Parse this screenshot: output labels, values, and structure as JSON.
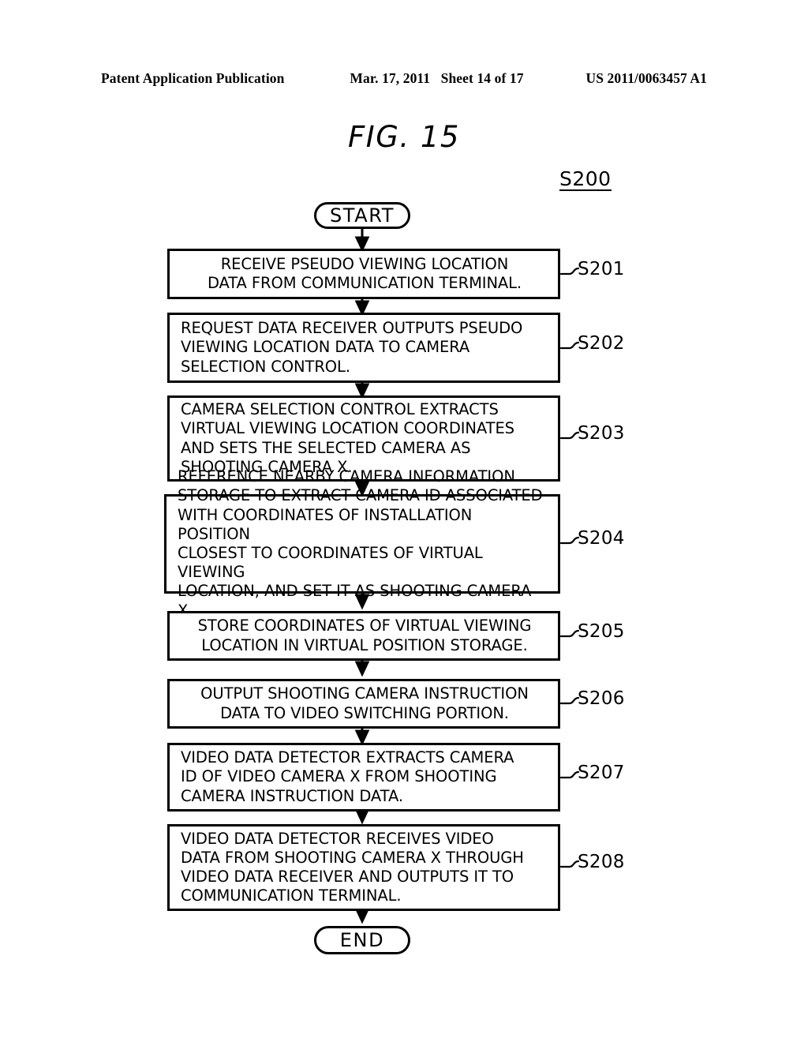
{
  "header": {
    "publication": "Patent Application Publication",
    "date": "Mar. 17, 2011",
    "sheet": "Sheet 14 of 17",
    "patent_number": "US 2011/0063457 A1"
  },
  "figure": {
    "title": "FIG. 15",
    "diagram_id": "S200"
  },
  "flow": {
    "start_label": "START",
    "end_label": "END",
    "steps": [
      {
        "ref": "S201",
        "text": "RECEIVE PSEUDO VIEWING LOCATION\nDATA FROM COMMUNICATION TERMINAL.",
        "align": "center"
      },
      {
        "ref": "S202",
        "text": "REQUEST DATA RECEIVER OUTPUTS PSEUDO\nVIEWING LOCATION DATA TO CAMERA\nSELECTION CONTROL.",
        "align": "left"
      },
      {
        "ref": "S203",
        "text": "CAMERA SELECTION CONTROL EXTRACTS\nVIRTUAL VIEWING LOCATION COORDINATES\nAND SETS THE SELECTED CAMERA AS\nSHOOTING CAMERA X.",
        "align": "left"
      },
      {
        "ref": "S204",
        "text": "REFERENCE NEARBY CAMERA INFORMATION\nSTORAGE TO EXTRACT CAMERA ID ASSOCIATED\nWITH COORDINATES OF INSTALLATION POSITION\nCLOSEST TO COORDINATES OF VIRTUAL VIEWING\nLOCATION, AND SET IT AS SHOOTING CAMERA X.",
        "align": "left"
      },
      {
        "ref": "S205",
        "text": "STORE COORDINATES OF VIRTUAL VIEWING\nLOCATION IN VIRTUAL POSITION STORAGE.",
        "align": "center"
      },
      {
        "ref": "S206",
        "text": "OUTPUT SHOOTING CAMERA INSTRUCTION\nDATA TO VIDEO SWITCHING PORTION.",
        "align": "center"
      },
      {
        "ref": "S207",
        "text": "VIDEO DATA DETECTOR EXTRACTS CAMERA\nID OF VIDEO CAMERA X FROM SHOOTING\nCAMERA INSTRUCTION DATA.",
        "align": "left"
      },
      {
        "ref": "S208",
        "text": "VIDEO DATA DETECTOR RECEIVES VIDEO\nDATA FROM SHOOTING CAMERA X THROUGH\nVIDEO DATA RECEIVER AND OUTPUTS IT TO\nCOMMUNICATION TERMINAL.",
        "align": "left"
      }
    ]
  },
  "colors": {
    "ink": "#000000",
    "paper": "#ffffff"
  }
}
